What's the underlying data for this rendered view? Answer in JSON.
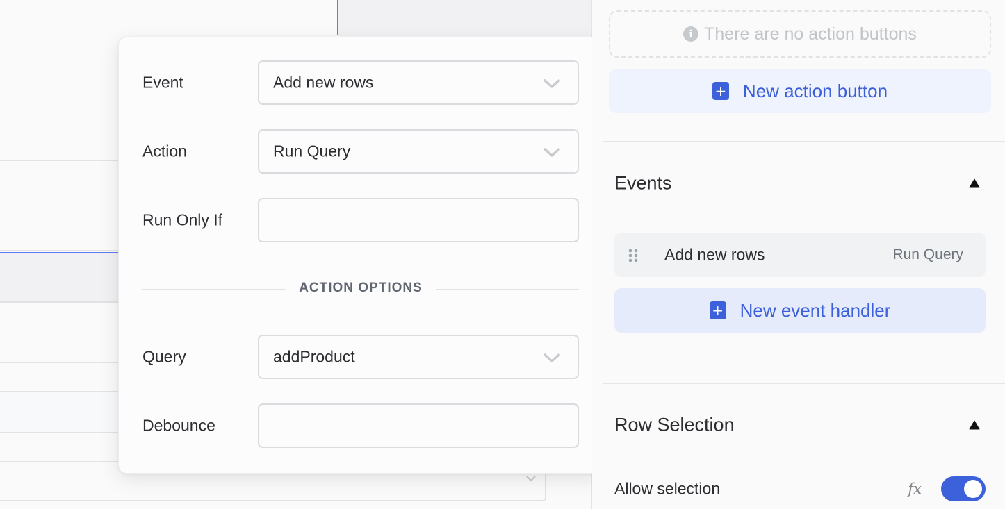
{
  "popover": {
    "fields": [
      {
        "label": "Event",
        "value": "Add new rows",
        "type": "select"
      },
      {
        "label": "Action",
        "value": "Run Query",
        "type": "select"
      },
      {
        "label": "Run Only If",
        "value": "",
        "type": "input"
      }
    ],
    "section_title": "ACTION OPTIONS",
    "option_fields": [
      {
        "label": "Query",
        "value": "addProduct",
        "type": "select"
      },
      {
        "label": "Debounce",
        "value": "",
        "type": "input"
      }
    ]
  },
  "panel": {
    "action_buttons": {
      "empty_text": "There are no action buttons",
      "empty_icon": "info-icon",
      "add_label": "New action button",
      "add_icon": "plus-icon"
    },
    "events": {
      "title": "Events",
      "collapse_icon": "caret-up-icon",
      "items": [
        {
          "event": "Add new rows",
          "action": "Run Query",
          "handle_icon": "drag-handle-icon"
        }
      ],
      "add_label": "New event handler",
      "add_icon": "plus-icon"
    },
    "row_selection": {
      "title": "Row Selection",
      "collapse_icon": "caret-up-icon",
      "allow_selection": {
        "label": "Allow selection",
        "fx_label": "fx",
        "enabled": true
      }
    }
  },
  "colors": {
    "accent": "#3d61db",
    "accent_bg": "#eef2fd",
    "canvas_selection": "#5b7cf0"
  }
}
